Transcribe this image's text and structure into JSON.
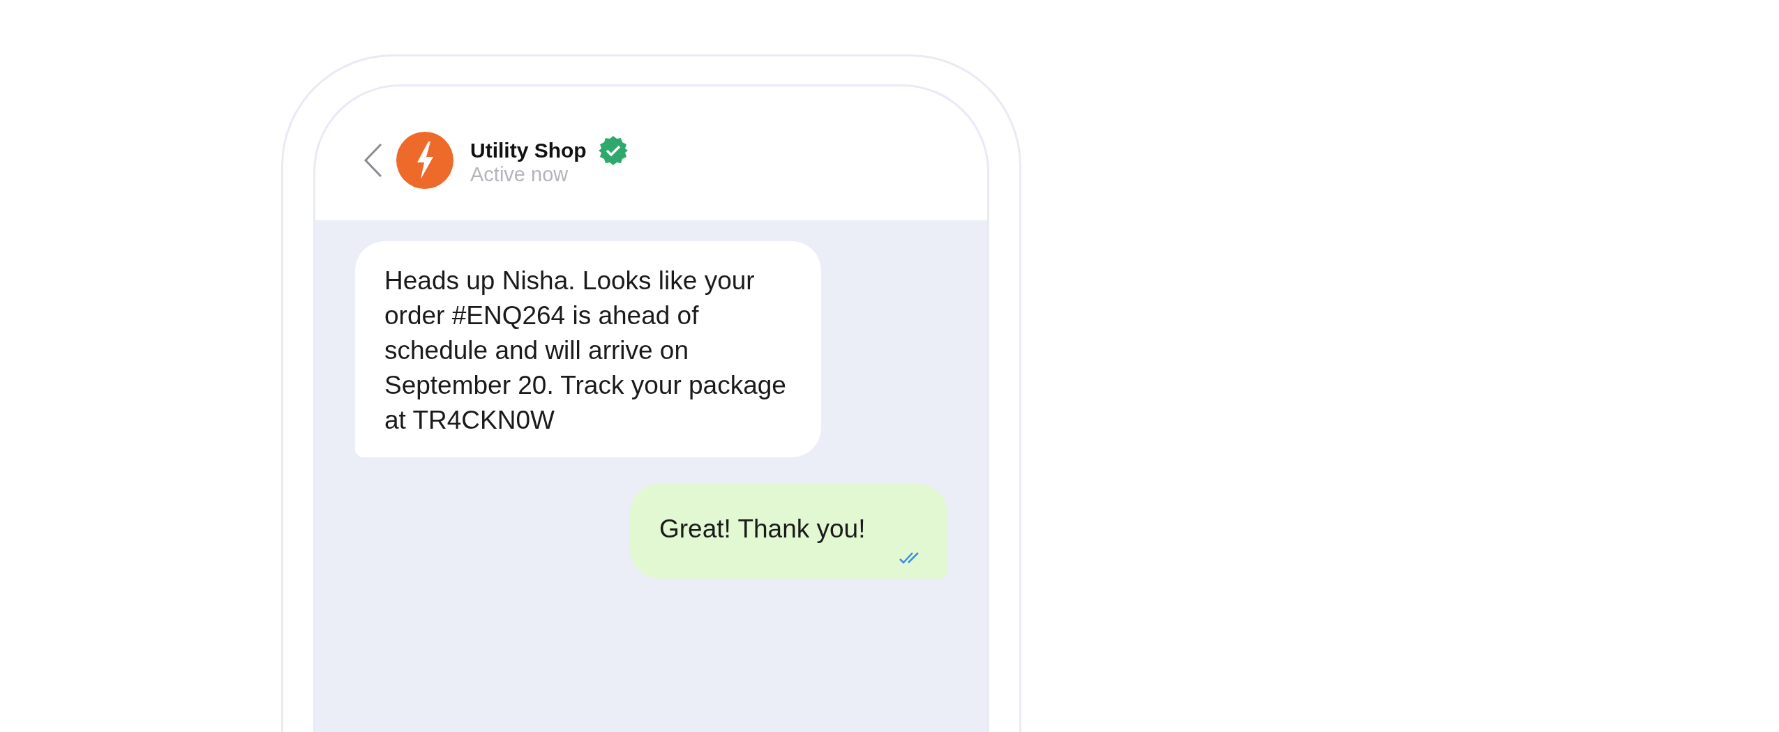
{
  "header": {
    "name": "Utility Shop",
    "status": "Active now"
  },
  "messages": [
    {
      "kind": "incoming",
      "text": "Heads up Nisha. Looks like your order #ENQ264 is ahead of schedule and will arrive on September 20. Track your package at TR4CKN0W"
    },
    {
      "kind": "outgoing",
      "text": "Great! Thank you!"
    }
  ]
}
